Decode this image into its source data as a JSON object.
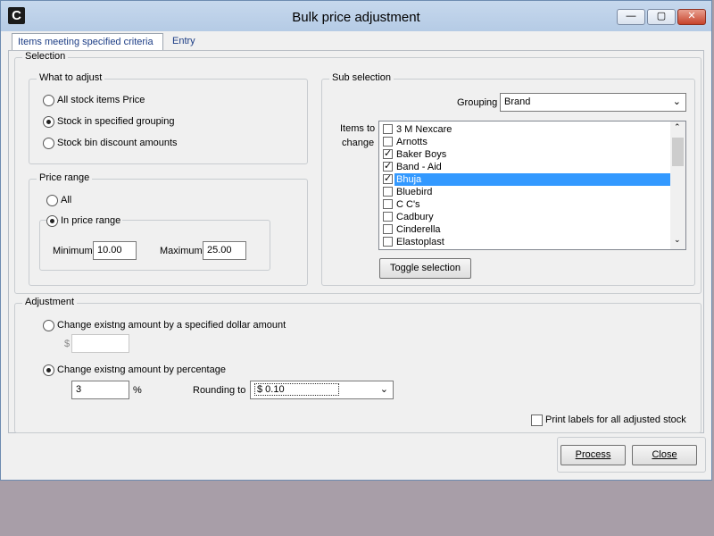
{
  "window": {
    "title": "Bulk price adjustment",
    "icon_letter": "C",
    "controls": {
      "minimize": "—",
      "maximize": "▢",
      "close": "✕"
    }
  },
  "tabs": [
    {
      "label": "Items meeting specified criteria",
      "active": true
    },
    {
      "label": "Entry",
      "active": false
    }
  ],
  "selection": {
    "legend": "Selection",
    "what_to_adjust": {
      "legend": "What to adjust",
      "options": [
        "All stock items Price",
        "Stock in specified grouping",
        "Stock bin discount amounts"
      ],
      "selected_index": 1
    },
    "price_range": {
      "legend": "Price range",
      "option_all": "All",
      "option_in_range": "In price range",
      "minimum_label": "Minimum",
      "minimum_value": "10.00",
      "maximum_label": "Maximum",
      "maximum_value": "25.00"
    },
    "sub_selection": {
      "legend": "Sub selection",
      "grouping_label": "Grouping",
      "grouping_value": "Brand",
      "items_label_line1": "Items to",
      "items_label_line2": "change",
      "items": [
        {
          "label": "3 M Nexcare",
          "checked": false,
          "selected": false
        },
        {
          "label": "Arnotts",
          "checked": false,
          "selected": false
        },
        {
          "label": "Baker Boys",
          "checked": true,
          "selected": false
        },
        {
          "label": "Band - Aid",
          "checked": true,
          "selected": false
        },
        {
          "label": "Bhuja",
          "checked": true,
          "selected": true
        },
        {
          "label": "Bluebird",
          "checked": false,
          "selected": false
        },
        {
          "label": "C C's",
          "checked": false,
          "selected": false
        },
        {
          "label": "Cadbury",
          "checked": false,
          "selected": false
        },
        {
          "label": "Cinderella",
          "checked": false,
          "selected": false
        },
        {
          "label": "Elastoplast",
          "checked": false,
          "selected": false
        }
      ],
      "toggle_button": "Toggle selection"
    }
  },
  "adjustment": {
    "legend": "Adjustment",
    "dollar_option": "Change existng amount by a specified dollar amount",
    "dollar_prefix": "$",
    "dollar_value": "",
    "percentage_option": "Change existng amount by percentage",
    "percentage_value": "3",
    "percentage_suffix": "%",
    "rounding_label": "Rounding to",
    "rounding_value": "$ 0.10",
    "selected": "percentage"
  },
  "print_labels": {
    "label": "Print labels for all adjusted stock",
    "checked": false
  },
  "buttons": {
    "process": "Process",
    "close": "Close"
  }
}
